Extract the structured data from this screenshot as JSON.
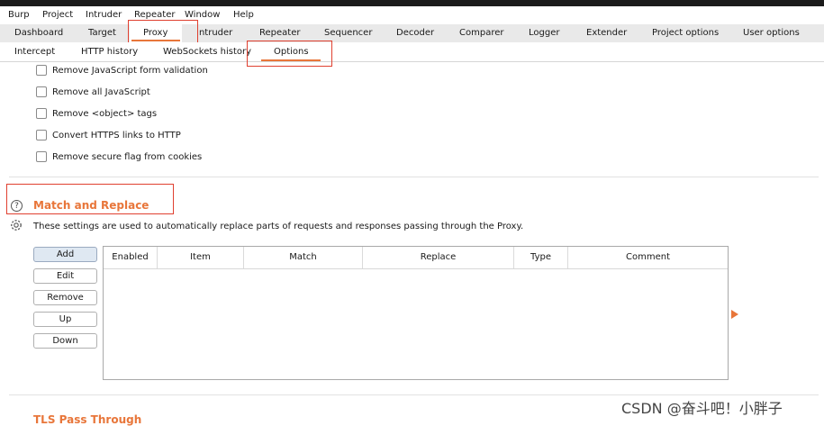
{
  "menu": [
    "Burp",
    "Project",
    "Intruder",
    "Repeater",
    "Window",
    "Help"
  ],
  "main_tabs": [
    "Dashboard",
    "Target",
    "Proxy",
    "Intruder",
    "Repeater",
    "Sequencer",
    "Decoder",
    "Comparer",
    "Logger",
    "Extender",
    "Project options",
    "User options"
  ],
  "active_main_tab": "Proxy",
  "proxy_tabs": [
    "Intercept",
    "HTTP history",
    "WebSockets history",
    "Options"
  ],
  "active_proxy_tab": "Options",
  "response_modification": {
    "options": [
      {
        "label": "Remove JavaScript form validation",
        "checked": false
      },
      {
        "label": "Remove all JavaScript",
        "checked": false
      },
      {
        "label": "Remove <object> tags",
        "checked": false
      },
      {
        "label": "Convert HTTPS links to HTTP",
        "checked": false
      },
      {
        "label": "Remove secure flag from cookies",
        "checked": false
      }
    ]
  },
  "match_replace": {
    "title": "Match and Replace",
    "description": "These settings are used to automatically replace parts of requests and responses passing through the Proxy.",
    "buttons": [
      "Add",
      "Edit",
      "Remove",
      "Up",
      "Down"
    ],
    "columns": [
      "Enabled",
      "Item",
      "Match",
      "Replace",
      "Type",
      "Comment"
    ],
    "rows": []
  },
  "tls": {
    "title": "TLS Pass Through"
  },
  "watermark": "CSDN @奋斗吧！小胖子",
  "colors": {
    "accent": "#e8763a",
    "highlight_box": "#e04030"
  }
}
